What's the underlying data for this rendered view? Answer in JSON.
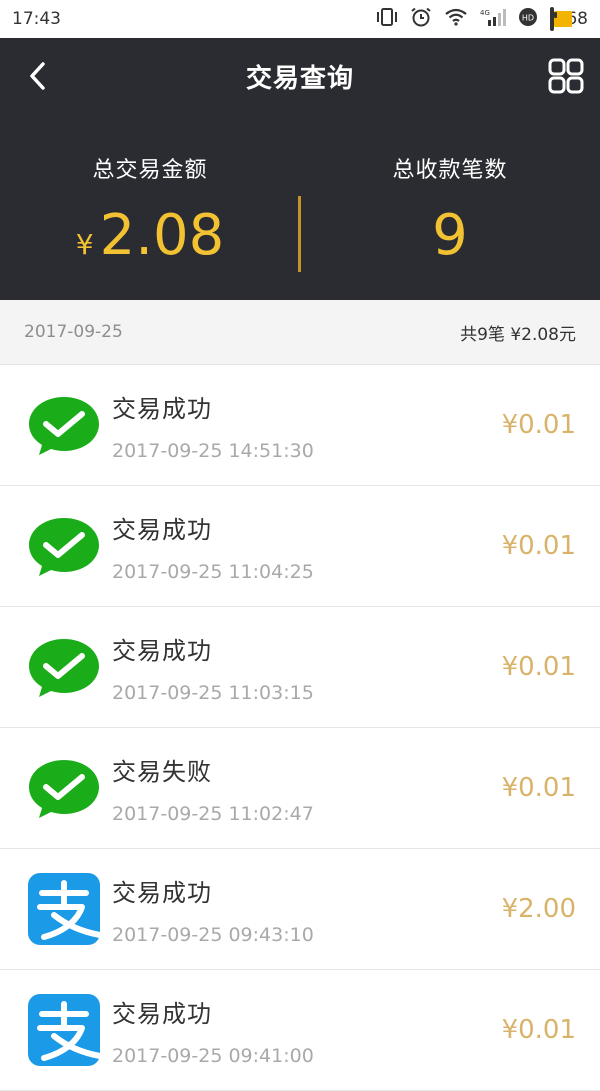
{
  "statusbar": {
    "time": "17:43",
    "battery_level": "68",
    "battery_fraction": 0.68,
    "network": "4G"
  },
  "header": {
    "title": "交易查询",
    "back_icon": "chevron-left-icon",
    "menu_icon": "grid-icon"
  },
  "summary": {
    "amount_label": "总交易金额",
    "currency": "¥",
    "amount": "2.08",
    "count_label": "总收款笔数",
    "count": "9"
  },
  "colors": {
    "header_bg": "#2a2c31",
    "accent_gold": "#f2c233",
    "price_gold": "#d9b36a",
    "wechat_green": "#1aad19",
    "alipay_blue": "#1b9ae8"
  },
  "date_group": {
    "date": "2017-09-25",
    "total": "共9笔  ¥2.08元"
  },
  "transactions": [
    {
      "method": "wechat",
      "status": "交易成功",
      "time": "2017-09-25 14:51:30",
      "amount": "¥0.01"
    },
    {
      "method": "wechat",
      "status": "交易成功",
      "time": "2017-09-25 11:04:25",
      "amount": "¥0.01"
    },
    {
      "method": "wechat",
      "status": "交易成功",
      "time": "2017-09-25 11:03:15",
      "amount": "¥0.01"
    },
    {
      "method": "wechat",
      "status": "交易失败",
      "time": "2017-09-25 11:02:47",
      "amount": "¥0.01"
    },
    {
      "method": "alipay",
      "status": "交易成功",
      "time": "2017-09-25 09:43:10",
      "amount": "¥2.00"
    },
    {
      "method": "alipay",
      "status": "交易成功",
      "time": "2017-09-25 09:41:00",
      "amount": "¥0.01"
    }
  ]
}
